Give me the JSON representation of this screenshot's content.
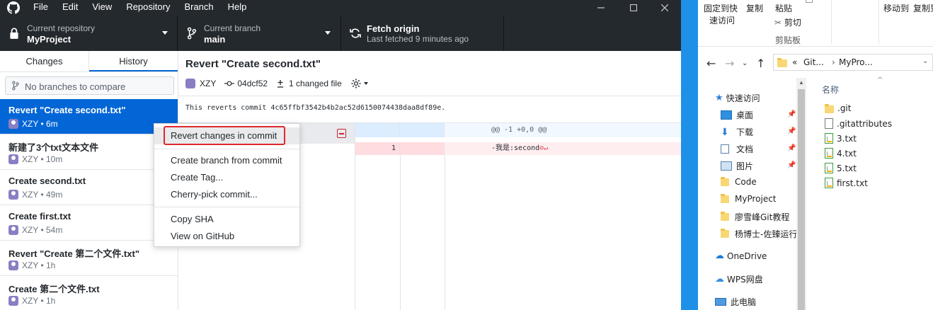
{
  "menubar": {
    "items": [
      "File",
      "Edit",
      "View",
      "Repository",
      "Branch",
      "Help"
    ]
  },
  "toolbar": {
    "repo_label": "Current repository",
    "repo_value": "MyProject",
    "branch_label": "Current branch",
    "branch_value": "main",
    "fetch_label": "Fetch origin",
    "fetch_sub": "Last fetched 9 minutes ago"
  },
  "sidebar": {
    "tabs": [
      "Changes",
      "History"
    ],
    "compare_placeholder": "No branches to compare",
    "commits": [
      {
        "title": "Revert \"Create second.txt\"",
        "meta": "XZY • 6m"
      },
      {
        "title": "新建了3个txt文本文件",
        "meta": "XZY • 10m"
      },
      {
        "title": "Create second.txt",
        "meta": "XZY • 49m"
      },
      {
        "title": "Create first.txt",
        "meta": "XZY • 54m"
      },
      {
        "title": "Revert \"Create 第二个文件.txt\"",
        "meta": "XZY • 1h"
      },
      {
        "title": "Create 第二个文件.txt",
        "meta": "XZY • 1h"
      }
    ]
  },
  "detail": {
    "title": "Revert \"Create second.txt\"",
    "author": "XZY",
    "sha": "04dcf52",
    "changed": "1 changed file",
    "body": "This reverts commit 4c65ffbf3542b4b2ac52d6150074438daa8df89e."
  },
  "diff": {
    "hunk": "@@ -1 +0,0 @@",
    "del_line_no": "1",
    "del_code": "-我是:second"
  },
  "context_menu": {
    "items": [
      "Revert changes in commit",
      "Create branch from commit",
      "Create Tag...",
      "Cherry-pick commit...",
      "Copy SHA",
      "View on GitHub"
    ]
  },
  "explorer": {
    "ribbon": {
      "pin": "固定到快",
      "pin2": "速访问",
      "copy": "复制",
      "paste": "粘贴",
      "cut": "剪切",
      "clipboard": "剪贴板",
      "moveto": "移动到",
      "copyto": "复制到"
    },
    "address": {
      "chev": "«",
      "seg1": "Git...",
      "seg2": "MyPro..."
    },
    "nav": [
      {
        "label": "快速访问"
      },
      {
        "label": "桌面"
      },
      {
        "label": "下载"
      },
      {
        "label": "文档"
      },
      {
        "label": "图片"
      },
      {
        "label": "Code"
      },
      {
        "label": "MyProject"
      },
      {
        "label": "廖雪峰Git教程"
      },
      {
        "label": "杨博士-佐臻运行"
      },
      {
        "label": "OneDrive"
      },
      {
        "label": "WPS网盘"
      },
      {
        "label": "此电脑"
      }
    ],
    "column_header": "名称",
    "files": [
      ".git",
      ".gitattributes",
      "3.txt",
      "4.txt",
      "5.txt",
      "first.txt"
    ]
  }
}
